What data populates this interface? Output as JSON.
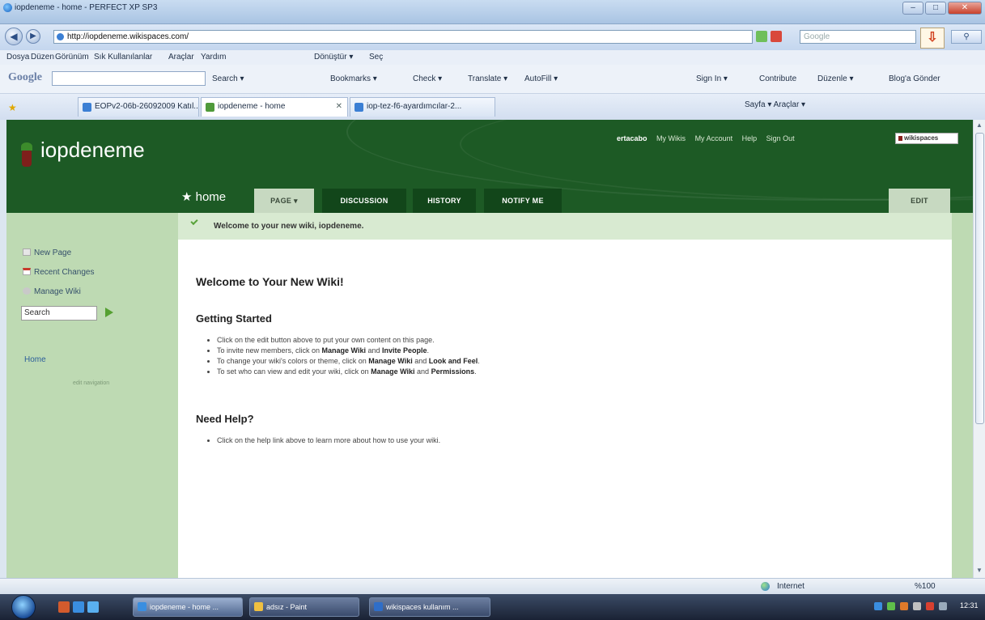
{
  "browser": {
    "window_title": "iopdeneme - home - PERFECT XP SP3",
    "url": "http://iopdeneme.wikispaces.com/",
    "search_placeholder": "Google",
    "menu": [
      "Dosya",
      "Düzen",
      "Görünüm",
      "Sık Kullanılanlar",
      "Araçlar",
      "Yardım"
    ],
    "menu_extra": [
      "Dönüştür ▾",
      "Seç"
    ],
    "google_toolbar": {
      "logo": "Google",
      "items": [
        "Search ▾",
        "Bookmarks ▾",
        "Check ▾",
        "Translate ▾",
        "AutoFill ▾",
        "Sign In ▾",
        "Contribute",
        "Düzenle ▾",
        "Blog'a Gönder"
      ]
    },
    "tabs": [
      {
        "label": "EOPv2-06b-26092009 Katıl...",
        "active": false
      },
      {
        "label": "iopdeneme - home",
        "active": true
      },
      {
        "label": "iop-tez-f6-ayardımcılar-2...",
        "active": false
      }
    ],
    "commands": "Sayfa ▾   Araçlar ▾",
    "status_zone": "Internet",
    "zoom": "%100"
  },
  "wiki": {
    "site_title": "iopdeneme",
    "username": "ertacabo",
    "user_links": [
      "My Wikis",
      "My Account",
      "Help",
      "Sign Out"
    ],
    "badge": "wikispaces",
    "page_name": "★ home",
    "tabs": {
      "page": "PAGE ▾",
      "discussion": "DISCUSSION",
      "history": "HISTORY",
      "notify": "NOTIFY ME",
      "edit": "EDIT"
    },
    "sidebar": {
      "new_page": "New Page",
      "recent_changes": "Recent Changes",
      "manage_wiki": "Manage Wiki",
      "search_value": "Search",
      "home": "Home",
      "edit_navigation": "edit navigation"
    },
    "flash_message": "Welcome to your new wiki, iopdeneme.",
    "content": {
      "heading": "Welcome to Your New Wiki!",
      "getting_started": "Getting Started",
      "gs_items": [
        {
          "a": "Click on the edit button above to put your own content on this page.",
          "b1": "",
          "m": "",
          "b2": "",
          "e": ""
        },
        {
          "a": "To invite new members, click on ",
          "b1": "Manage Wiki",
          "m": " and ",
          "b2": "Invite People",
          "e": "."
        },
        {
          "a": "To change your wiki's colors or theme, click on ",
          "b1": "Manage Wiki",
          "m": " and ",
          "b2": "Look and Feel",
          "e": "."
        },
        {
          "a": "To set who can view and edit your wiki, click on ",
          "b1": "Manage Wiki",
          "m": " and ",
          "b2": "Permissions",
          "e": "."
        }
      ],
      "need_help": "Need Help?",
      "help_items": [
        "Click on the help link above to learn more about how to use your wiki."
      ]
    }
  },
  "taskbar": {
    "tasks": [
      {
        "label": "iopdeneme - home ...",
        "active": true
      },
      {
        "label": "adsız - Paint",
        "active": false
      },
      {
        "label": "wikispaces kullanım ...",
        "active": false
      }
    ],
    "clock": "12:31"
  },
  "colors": {
    "header_green": "#1d5a25",
    "sidebar_green": "#bedab3",
    "flash_green": "#d8ead1"
  }
}
